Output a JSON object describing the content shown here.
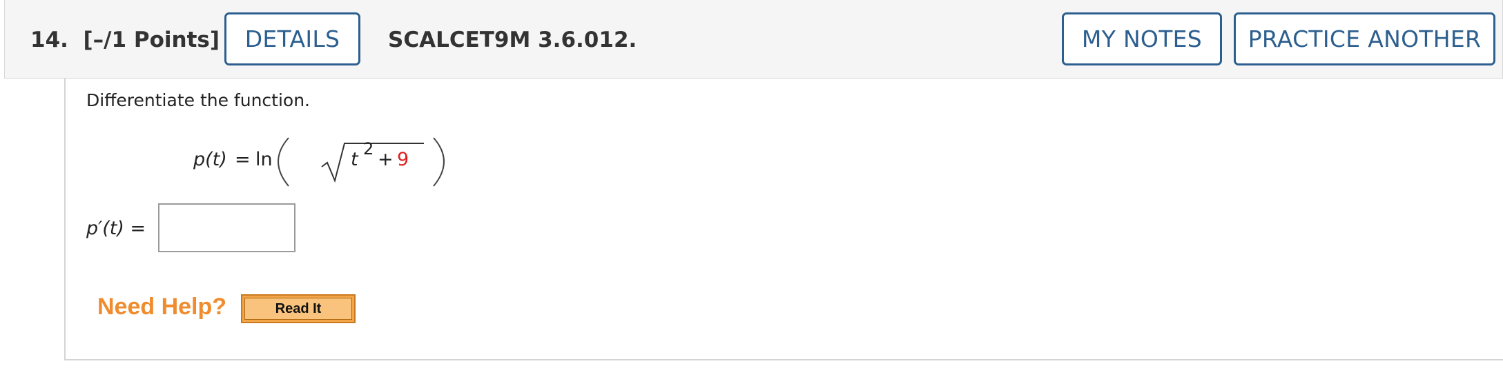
{
  "header": {
    "question_number": "14.",
    "points": "[–/1 Points]",
    "details_label": "DETAILS",
    "question_code": "SCALCET9M 3.6.012.",
    "my_notes_label": "MY NOTES",
    "practice_another_label": "PRACTICE ANOTHER"
  },
  "problem": {
    "instruction": "Differentiate the function.",
    "function_name": "p(t)",
    "equals": "=",
    "ln": "ln",
    "var": "t",
    "exponent": "2",
    "plus": "+",
    "constant": "9",
    "constant_color": "#e02020"
  },
  "answer": {
    "label_func": "p′(t)",
    "label_equals": "=",
    "value": ""
  },
  "help": {
    "need_help": "Need Help?",
    "read_it": "Read It"
  },
  "colors": {
    "button_accent": "#2c5f8f",
    "need_help": "#f08c2d",
    "read_it_bg": "#f3a548"
  }
}
